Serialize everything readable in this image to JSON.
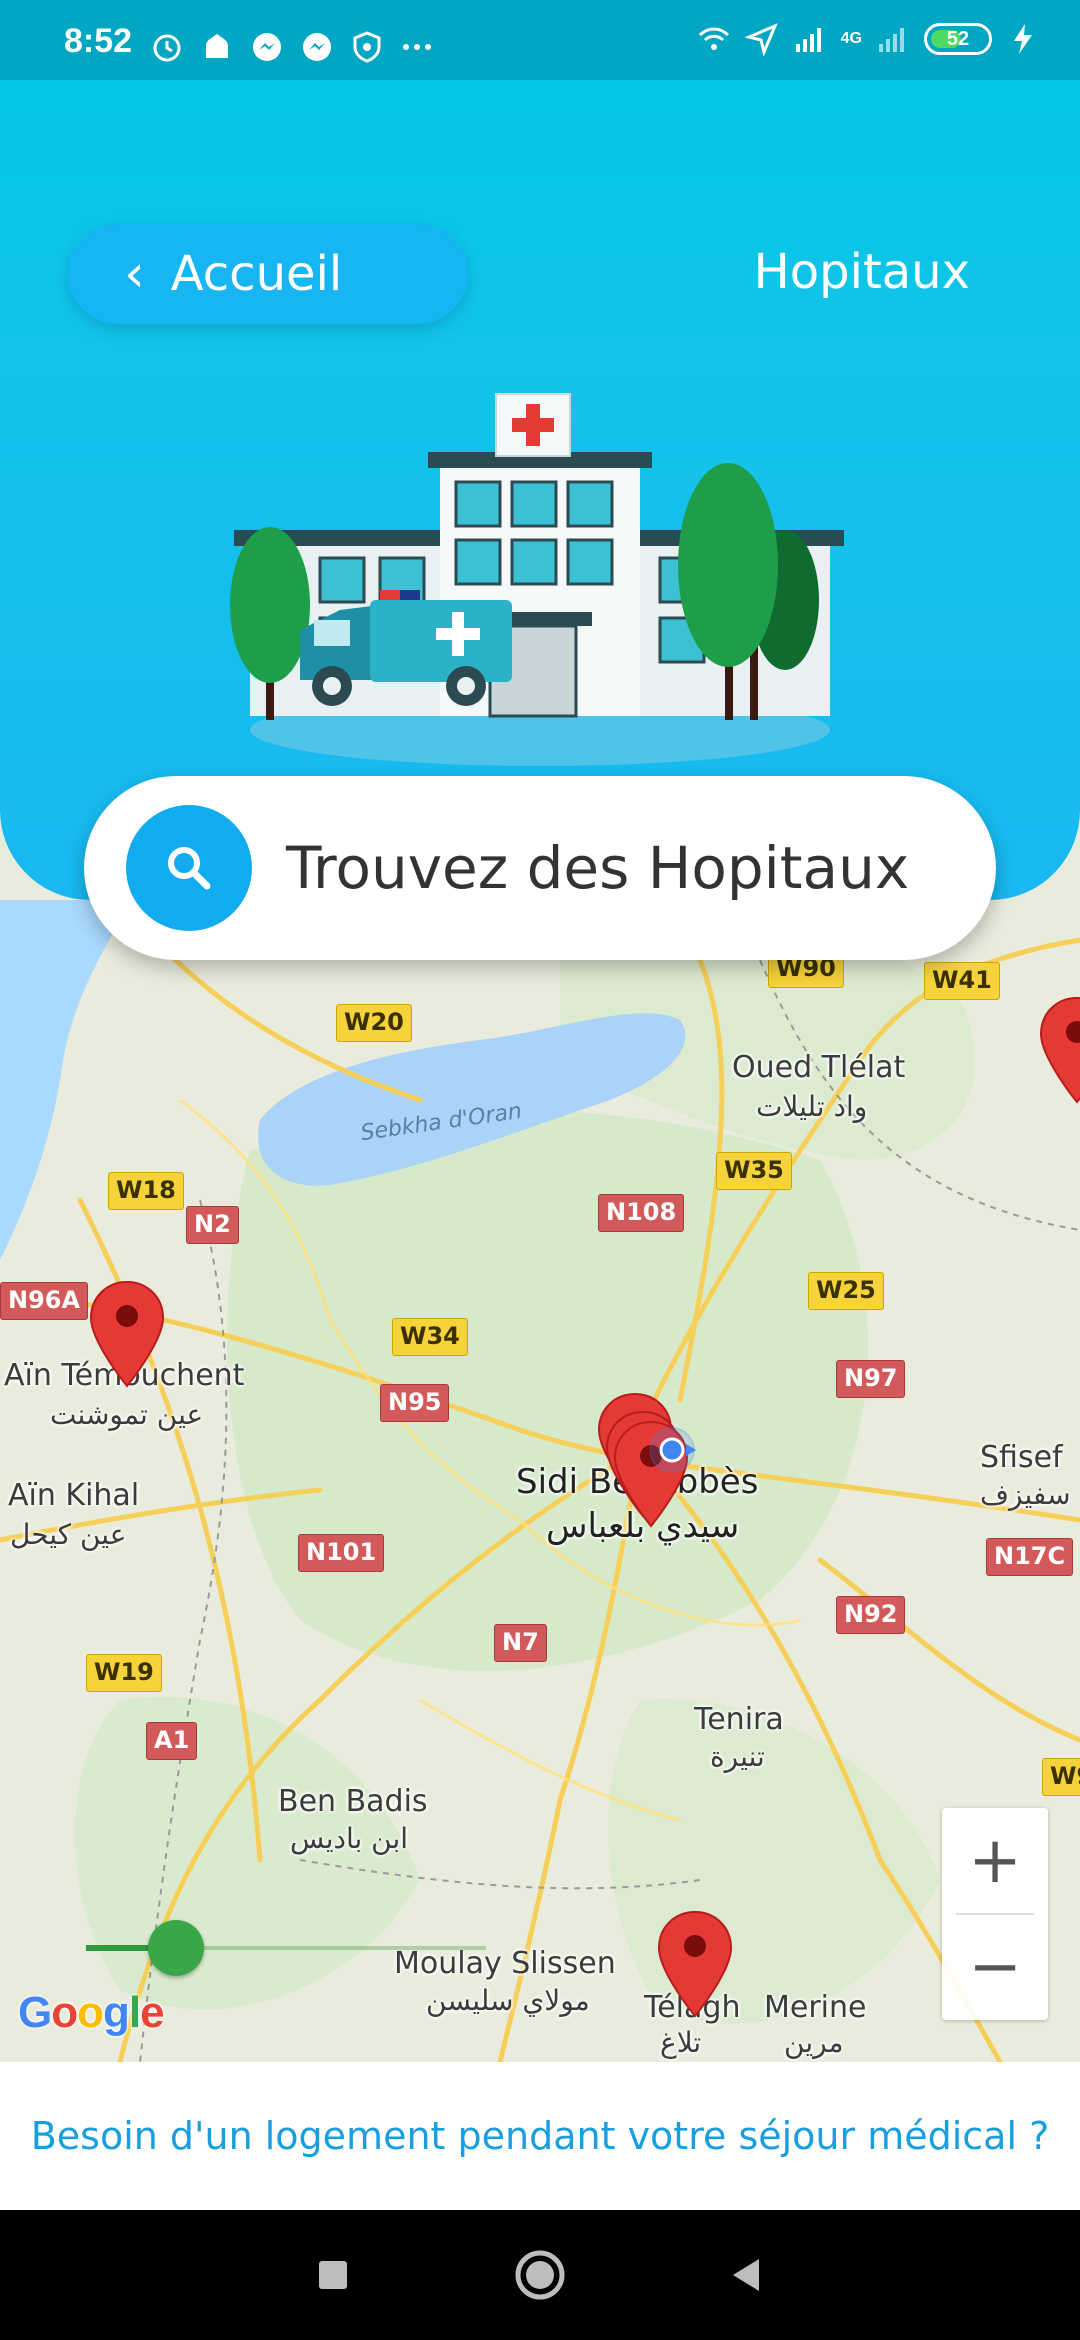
{
  "status_bar": {
    "time": "8:52",
    "network": "4G",
    "battery": "52"
  },
  "header": {
    "back_label": "Accueil",
    "title": "Hopitaux"
  },
  "search": {
    "placeholder": "Trouvez des Hopitaux"
  },
  "map": {
    "water_label": "Sebkha d'Oran",
    "places": [
      {
        "name": "Oued Tlélat",
        "ar": "واد تليلات"
      },
      {
        "name": "Aïn Témouchent",
        "ar": "عين تموشنت"
      },
      {
        "name": "Aïn Kihal",
        "ar": "عين كيحل"
      },
      {
        "name": "Sidi Bel Abbès",
        "ar": "سيدي بلعباس"
      },
      {
        "name": "Sfisef",
        "ar": "سفيزف"
      },
      {
        "name": "Tenira",
        "ar": "تنيرة"
      },
      {
        "name": "Ben Badis",
        "ar": "ابن باديس"
      },
      {
        "name": "Moulay Slissen",
        "ar": "مولاي سليسن"
      },
      {
        "name": "Télagh",
        "ar": "تلاغ"
      },
      {
        "name": "Merine",
        "ar": "مرين"
      }
    ],
    "roads": [
      "W90",
      "W41",
      "W20",
      "W18",
      "N2",
      "W35",
      "N108",
      "N96A",
      "W25",
      "W34",
      "N95",
      "N97",
      "N101",
      "N17C",
      "N7",
      "N92",
      "W19",
      "A1",
      "W9"
    ],
    "zoom_in": "+",
    "zoom_out": "−",
    "radius_fraction": 0.18,
    "logo": "Google"
  },
  "footer": {
    "link": "Besoin d'un logement pendant votre séjour médical ?"
  },
  "colors": {
    "header_gradient_top": "#00c6e4",
    "accent_blue": "#13abef",
    "pin_red": "#e53935",
    "link_blue": "#1a9ede"
  }
}
